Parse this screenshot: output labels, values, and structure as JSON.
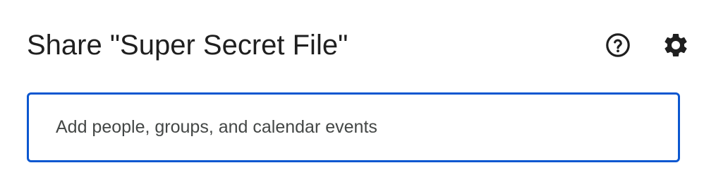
{
  "dialog": {
    "title": "Share \"Super Secret File\"",
    "help_icon": "help-circle-icon",
    "settings_icon": "gear-icon"
  },
  "add_people": {
    "placeholder": "Add people, groups, and calendar events",
    "value": ""
  },
  "colors": {
    "focus_border": "#0b57d0",
    "title_text": "#1f1f1f",
    "placeholder_text": "#444746"
  }
}
